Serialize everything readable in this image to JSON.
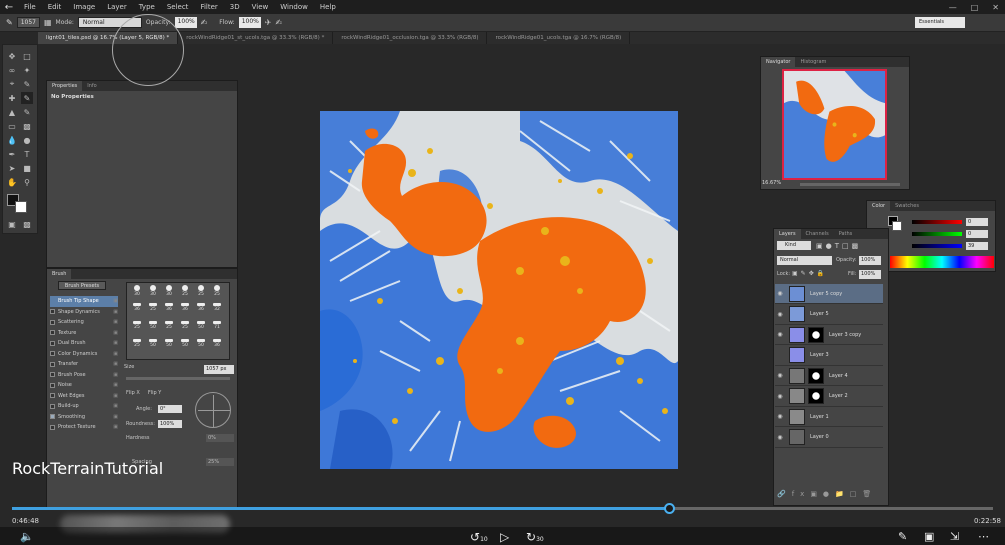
{
  "menu": {
    "items": [
      "File",
      "Edit",
      "Image",
      "Layer",
      "Type",
      "Select",
      "Filter",
      "3D",
      "View",
      "Window",
      "Help"
    ]
  },
  "options_bar": {
    "brush_size": "1057",
    "mode_label": "Mode:",
    "mode_value": "Normal",
    "opacity_label": "Opacity:",
    "opacity_value": "100%",
    "flow_label": "Flow:",
    "flow_value": "100%"
  },
  "workspace": "Essentials",
  "tabs": [
    {
      "label": "lignt01_tiles.psd @ 16.7% (Layer 5, RGB/8) *",
      "active": true
    },
    {
      "label": "rockWindRidge01_st_ucols.tga @ 33.3% (RGB/8) *",
      "active": false
    },
    {
      "label": "rockWindRidge01_occlusion.tga @ 33.3% (RGB/8)",
      "active": false
    },
    {
      "label": "rockWindRidge01_ucols.tga @ 16.7% (RGB/8)",
      "active": false
    }
  ],
  "properties": {
    "tabs": [
      "Properties",
      "Info"
    ],
    "empty_label": "No Properties"
  },
  "brush": {
    "tab": "Brush",
    "presets_button": "Brush Presets",
    "items": [
      {
        "label": "Brush Tip Shape",
        "checked": false,
        "selected": true
      },
      {
        "label": "Shape Dynamics",
        "checked": false
      },
      {
        "label": "Scattering",
        "checked": false
      },
      {
        "label": "Texture",
        "checked": false
      },
      {
        "label": "Dual Brush",
        "checked": false
      },
      {
        "label": "Color Dynamics",
        "checked": false
      },
      {
        "label": "Transfer",
        "checked": false
      },
      {
        "label": "Brush Pose",
        "checked": false
      },
      {
        "label": "Noise",
        "checked": false
      },
      {
        "label": "Wet Edges",
        "checked": false
      },
      {
        "label": "Build-up",
        "checked": false
      },
      {
        "label": "Smoothing",
        "checked": true
      },
      {
        "label": "Protect Texture",
        "checked": false
      }
    ],
    "tip_sizes": [
      "30",
      "30",
      "30",
      "25",
      "25",
      "25",
      "36",
      "25",
      "36",
      "36",
      "36",
      "32",
      "25",
      "50",
      "25",
      "25",
      "50",
      "71",
      "25",
      "50",
      "50",
      "50",
      "50",
      "36"
    ],
    "size_label": "Size",
    "size_value": "1057 px",
    "flip_x": "Flip X",
    "flip_y": "Flip Y",
    "angle_label": "Angle:",
    "angle_value": "0°",
    "roundness_label": "Roundness:",
    "roundness_value": "100%",
    "hardness_label": "Hardness",
    "hardness_value": "0%",
    "spacing_label": "Spacing",
    "spacing_value": "25%"
  },
  "navigator": {
    "tabs": [
      "Navigator",
      "Histogram"
    ],
    "zoom": "16.67%"
  },
  "color": {
    "tabs": [
      "Color",
      "Swatches"
    ],
    "r": "0",
    "g": "0",
    "b": "39"
  },
  "layers": {
    "tabs": [
      "Layers",
      "Channels",
      "Paths"
    ],
    "filter_label": "Kind",
    "blend_mode": "Normal",
    "opacity_label": "Opacity:",
    "opacity_value": "100%",
    "lock_label": "Lock:",
    "fill_label": "Fill:",
    "fill_value": "100%",
    "items": [
      {
        "name": "Layer 5 copy",
        "selected": true,
        "visible": true,
        "mask": false
      },
      {
        "name": "Layer 5",
        "selected": false,
        "visible": true,
        "mask": false
      },
      {
        "name": "Layer 3 copy",
        "selected": false,
        "visible": true,
        "mask": true
      },
      {
        "name": "Layer 3",
        "selected": false,
        "visible": false,
        "mask": false
      },
      {
        "name": "Layer 4",
        "selected": false,
        "visible": true,
        "mask": true
      },
      {
        "name": "Layer 2",
        "selected": false,
        "visible": true,
        "mask": true
      },
      {
        "name": "Layer 1",
        "selected": false,
        "visible": true,
        "mask": false
      },
      {
        "name": "Layer 0",
        "selected": false,
        "visible": true,
        "mask": false
      }
    ]
  },
  "player": {
    "title": "RockTerrainTutorial",
    "current_time": "0:46:48",
    "total_time": "0:22:58",
    "progress": 0.67,
    "volume_icon": "volume-icon",
    "rewind_label": "10",
    "forward_label": "30"
  },
  "colors": {
    "orange": "#f26a10",
    "blue": "#1f63d8",
    "white": "#e8ecef",
    "accent": "#3fa0e0"
  }
}
